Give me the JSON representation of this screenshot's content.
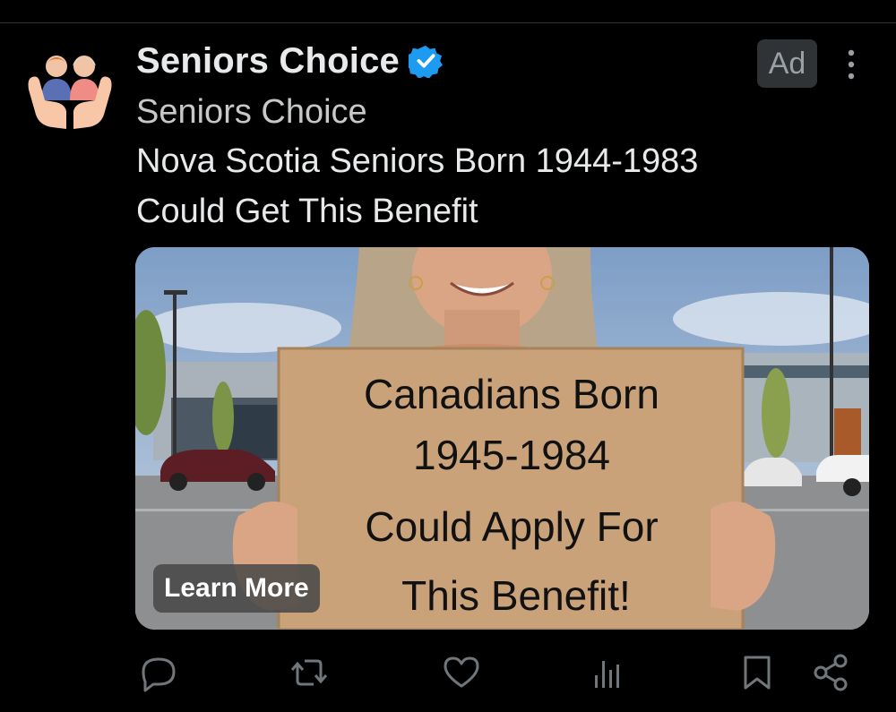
{
  "post": {
    "display_name": "Seniors Choice",
    "handle_line": "Seniors Choice",
    "body_lines": [
      "Nova Scotia Seniors Born 1944-1983",
      "Could Get This Benefit"
    ],
    "ad_label": "Ad"
  },
  "media": {
    "sign_lines": [
      "Canadians Born",
      "1945-1984",
      "Could Apply For",
      "This Benefit!"
    ],
    "cta_label": "Learn More"
  },
  "actions": [
    "reply-icon",
    "repost-icon",
    "like-icon",
    "views-icon",
    "bookmark-icon",
    "share-icon"
  ],
  "colors": {
    "background": "#000000",
    "verified": "#1d9bf0",
    "text": "#e7e9ea"
  }
}
